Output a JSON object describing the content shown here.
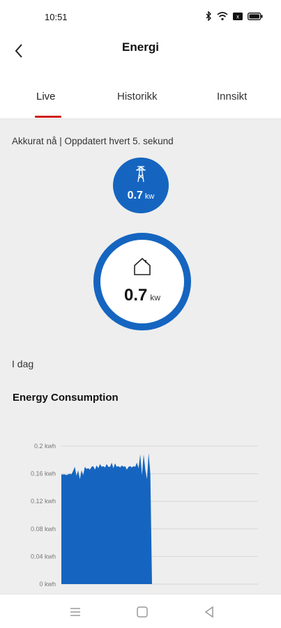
{
  "status_bar": {
    "time": "10:51",
    "icons": [
      "bluetooth-icon",
      "wifi-icon",
      "sim-icon",
      "battery-icon"
    ]
  },
  "header": {
    "title": "Energi",
    "back_icon": "chevron-left-icon"
  },
  "tabs": [
    {
      "label": "Live",
      "active": true
    },
    {
      "label": "Historikk",
      "active": false
    },
    {
      "label": "Innsikt",
      "active": false
    }
  ],
  "live": {
    "subtitle": "Akkurat nå | Oppdatert hvert 5. sekund",
    "grid": {
      "icon": "power-pylon-icon",
      "value": "0.7",
      "unit": "kw"
    },
    "home": {
      "icon": "house-icon",
      "value": "0.7",
      "unit": "kw"
    }
  },
  "today_label": "I dag",
  "chart_title": "Energy Consumption",
  "colors": {
    "accent": "#d0201c",
    "primary": "#1565c0"
  },
  "chart_data": {
    "type": "area",
    "title": "Energy Consumption",
    "ylabel": "",
    "xlabel": "",
    "ylim": [
      0,
      0.2
    ],
    "y_ticks": [
      "0 kwh",
      "0.04 kwh",
      "0.08 kwh",
      "0.12 kwh",
      "0.16 kwh",
      "0.2 kwh"
    ],
    "y_tick_values": [
      0,
      0.04,
      0.08,
      0.12,
      0.16,
      0.2
    ],
    "grid": true,
    "series": [
      {
        "values": [
          0.159,
          0.159,
          0.159,
          0.158,
          0.159,
          0.16,
          0.159,
          0.164,
          0.17,
          0.157,
          0.165,
          0.152,
          0.165,
          0.158,
          0.17,
          0.167,
          0.168,
          0.166,
          0.17,
          0.171,
          0.166,
          0.172,
          0.168,
          0.174,
          0.17,
          0.171,
          0.169,
          0.174,
          0.17,
          0.17,
          0.176,
          0.168,
          0.175,
          0.17,
          0.171,
          0.169,
          0.172,
          0.17,
          0.171,
          0.166,
          0.17,
          0.171,
          0.169,
          0.171,
          0.17,
          0.176,
          0.168,
          0.188,
          0.158,
          0.188,
          0.166,
          0.152,
          0.19,
          0.16,
          0.0
        ]
      }
    ]
  },
  "bottom_nav": [
    {
      "icon": "menu-icon"
    },
    {
      "icon": "home-square-icon"
    },
    {
      "icon": "back-triangle-icon"
    }
  ]
}
